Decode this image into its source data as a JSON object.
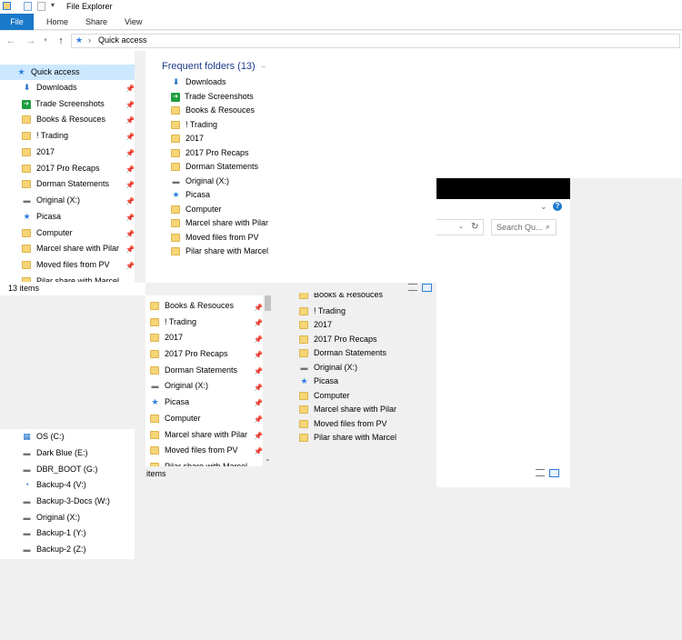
{
  "window": {
    "title": "File Explorer"
  },
  "ribbon": {
    "tabs": [
      "File",
      "Home",
      "Share",
      "View"
    ]
  },
  "address": {
    "path": "Quick access",
    "separator": "›"
  },
  "sidebar": {
    "quick_access": "Quick access",
    "items": [
      {
        "label": "Downloads",
        "icon": "download-icon"
      },
      {
        "label": "Trade Screenshots",
        "icon": "green-folder-icon"
      },
      {
        "label": "Books & Resouces",
        "icon": "folder-icon"
      },
      {
        "label": "! Trading",
        "icon": "folder-icon"
      },
      {
        "label": "2017",
        "icon": "folder-icon"
      },
      {
        "label": "2017 Pro Recaps",
        "icon": "folder-icon"
      },
      {
        "label": "Dorman Statements",
        "icon": "folder-icon"
      },
      {
        "label": "Original (X:)",
        "icon": "network-drive-icon"
      },
      {
        "label": "Picasa",
        "icon": "star-icon"
      },
      {
        "label": "Computer",
        "icon": "folder-icon"
      },
      {
        "label": "Marcel share with Pilar",
        "icon": "folder-icon"
      },
      {
        "label": "Moved files from PV",
        "icon": "folder-icon"
      },
      {
        "label": "Pilar share with Marcel",
        "icon": "folder-icon"
      }
    ],
    "drives": [
      {
        "label": "OS (C:)",
        "icon": "windows-drive-icon"
      },
      {
        "label": "Dark Blue (E:)",
        "icon": "drive-icon"
      },
      {
        "label": "DBR_BOOT (G:)",
        "icon": "drive-icon"
      },
      {
        "label": "Backup-4 (V:)",
        "icon": "backup-drive-icon"
      },
      {
        "label": "Backup-3-Docs (W:)",
        "icon": "network-drive-icon"
      },
      {
        "label": "Original (X:)",
        "icon": "network-drive-icon"
      },
      {
        "label": "Backup-1 (Y:)",
        "icon": "network-drive-icon"
      },
      {
        "label": "Backup-2 (Z:)",
        "icon": "network-drive-icon"
      }
    ]
  },
  "status": {
    "count": "13 items",
    "count2": "items"
  },
  "frequent": {
    "heading": "Frequent folders (13)",
    "items": [
      {
        "label": "Downloads",
        "icon": "download-icon"
      },
      {
        "label": "Trade Screenshots",
        "icon": "green-folder-icon"
      },
      {
        "label": "Books & Resouces",
        "icon": "folder-icon"
      },
      {
        "label": "! Trading",
        "icon": "folder-icon"
      },
      {
        "label": "2017",
        "icon": "folder-icon"
      },
      {
        "label": "2017 Pro Recaps",
        "icon": "folder-icon"
      },
      {
        "label": "Dorman Statements",
        "icon": "folder-icon"
      },
      {
        "label": "Original (X:)",
        "icon": "network-drive-icon"
      },
      {
        "label": "Picasa",
        "icon": "star-icon"
      },
      {
        "label": "Computer",
        "icon": "folder-icon"
      },
      {
        "label": "Marcel share with Pilar",
        "icon": "folder-icon"
      },
      {
        "label": "Moved files from PV",
        "icon": "folder-icon"
      },
      {
        "label": "Pilar share with Marcel",
        "icon": "folder-icon"
      }
    ]
  },
  "ghost_list": {
    "items": [
      {
        "label": "Books & Resouces",
        "icon": "folder-icon"
      },
      {
        "label": "! Trading",
        "icon": "folder-icon"
      },
      {
        "label": "2017",
        "icon": "folder-icon"
      },
      {
        "label": "2017 Pro Recaps",
        "icon": "folder-icon"
      },
      {
        "label": "Dorman Statements",
        "icon": "folder-icon"
      },
      {
        "label": "Original (X:)",
        "icon": "network-drive-icon"
      },
      {
        "label": "Picasa",
        "icon": "star-icon"
      },
      {
        "label": "Computer",
        "icon": "folder-icon"
      },
      {
        "label": "Marcel share with Pilar",
        "icon": "folder-icon"
      },
      {
        "label": "Moved files from PV",
        "icon": "folder-icon"
      },
      {
        "label": "Pilar share with Marcel",
        "icon": "folder-icon"
      }
    ]
  },
  "ghost_right": {
    "items": [
      {
        "label": "Books & Resouces",
        "icon": "folder-icon"
      },
      {
        "label": "! Trading",
        "icon": "folder-icon"
      },
      {
        "label": "2017",
        "icon": "folder-icon"
      },
      {
        "label": "2017 Pro Recaps",
        "icon": "folder-icon"
      },
      {
        "label": "Dorman Statements",
        "icon": "folder-icon"
      },
      {
        "label": "Original (X:)",
        "icon": "network-drive-icon"
      },
      {
        "label": "Picasa",
        "icon": "star-icon"
      },
      {
        "label": "Computer",
        "icon": "folder-icon"
      },
      {
        "label": "Marcel share with Pilar",
        "icon": "folder-icon"
      },
      {
        "label": "Moved files from PV",
        "icon": "folder-icon"
      },
      {
        "label": "Pilar share with Marcel",
        "icon": "folder-icon"
      }
    ]
  },
  "ghost_search": {
    "placeholder": "Search Qu..."
  },
  "colors": {
    "accent": "#1979ca",
    "selected": "#cce8ff",
    "folder": "#f6d577"
  }
}
